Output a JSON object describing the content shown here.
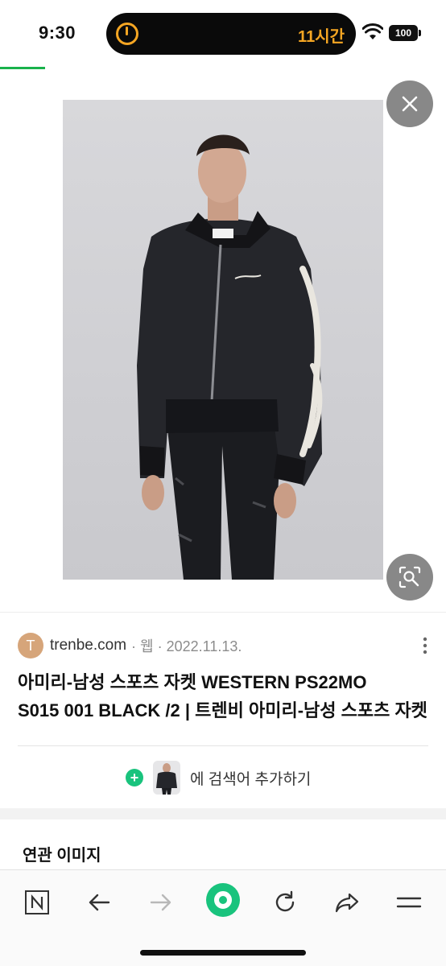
{
  "status_bar": {
    "time": "9:30",
    "island_text": "11시간",
    "battery": "100",
    "icons": [
      "timer-icon",
      "wifi-icon",
      "battery-icon"
    ],
    "accent_color": "#f5a623"
  },
  "viewer": {
    "image_alt": "black bomber jacket worn by model",
    "close_icon": "close-icon",
    "lens_icon": "image-search-icon"
  },
  "result": {
    "favicon_letter": "T",
    "source": "trenbe.com",
    "meta": "· 웹 · 2022.11.13.",
    "title_line1": "아미리-남성 스포츠 자켓 WESTERN PS22MO",
    "title_line2": "S015 001 BLACK /2 | 트렌비 아미리-남성 스포츠 자켓",
    "add_search_label": "에 검색어 추가하기"
  },
  "related": {
    "heading": "연관 이미지"
  },
  "toolbar": {
    "items": [
      "naver-n-icon",
      "back-icon",
      "forward-icon",
      "green-home-icon",
      "refresh-icon",
      "share-icon",
      "menu-icon"
    ],
    "brand_color": "#19c37d"
  }
}
